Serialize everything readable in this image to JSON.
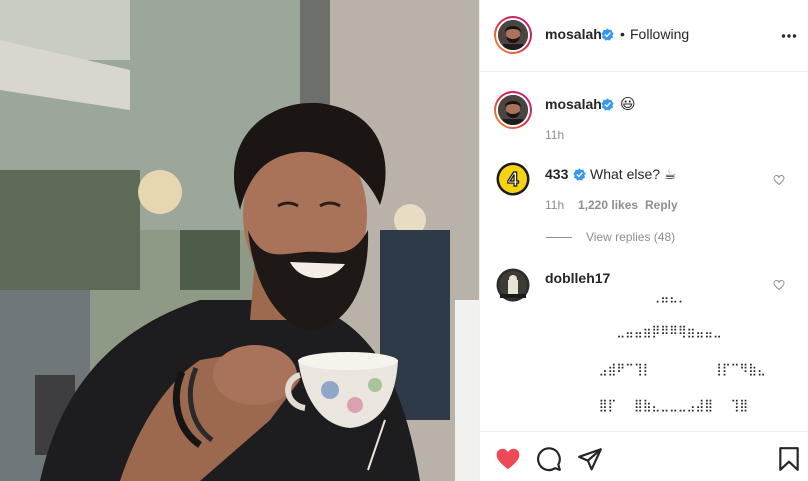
{
  "post": {
    "author": "mosalah",
    "follow_sep": "•",
    "follow_status": "Following",
    "caption_emoji": "😃",
    "caption_time": "11h"
  },
  "comments": [
    {
      "username": "433",
      "text": "What else? ☕",
      "time": "11h",
      "likes": "1,220 likes",
      "reply": "Reply",
      "view_replies": "View replies (48)"
    },
    {
      "username": "doblleh17",
      "ascii_art": [
        "⠀⠀⠀⠀⠀⠀⠀⢀⣤⣄⡀",
        "⠀⠀⠀⣀⣤⣤⣶⡿⠿⠿⢿⣶⣤⣤⣀",
        "⠀⣠⣾⠟⠉⢹⡇⠀⠀⠀⠀⠀⠀⠀⢸⡏⠉⠻⣷⣄",
        "⠀⣿⡏⠀⠀⣿⣷⣄⣀⣀⣀⣠⣼⣿⠀⠀⢹⣿"
      ]
    }
  ],
  "icons": {
    "more": "more-options-icon",
    "verified": "verified-badge-icon",
    "like": "heart-icon",
    "comment": "comment-icon",
    "share": "share-icon",
    "save": "bookmark-icon"
  },
  "colors": {
    "verified_blue": "#3897f0",
    "like_red": "#ed4956",
    "muted": "#8e8e8e"
  }
}
